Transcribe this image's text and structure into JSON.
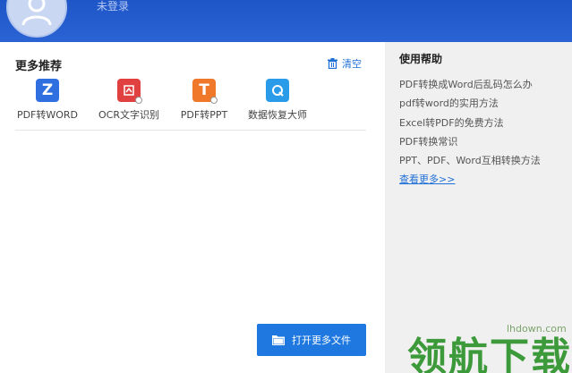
{
  "header": {
    "login_status": "未登录"
  },
  "recommend": {
    "title": "更多推荐",
    "clear_label": "清空",
    "apps": [
      {
        "label": "PDF转WORD",
        "icon": "pdf-to-word-icon",
        "glyph": "Z",
        "color": "#2f6fe0"
      },
      {
        "label": "OCR文字识别",
        "icon": "ocr-icon",
        "glyph": "⎙",
        "color": "#e0403f"
      },
      {
        "label": "PDF转PPT",
        "icon": "pdf-to-ppt-icon",
        "glyph": "T",
        "color": "#f0782a"
      },
      {
        "label": "数据恢复大师",
        "icon": "data-recovery-icon",
        "glyph": "Q",
        "color": "#2a9be8"
      }
    ]
  },
  "open_more_label": "打开更多文件",
  "help": {
    "title": "使用帮助",
    "items": [
      "PDF转换成Word后乱码怎么办",
      "pdf转word的实用方法",
      "Excel转PDF的免费方法",
      "PDF转换常识",
      "PPT、PDF、Word互相转换方法"
    ],
    "see_more": "查看更多>>"
  },
  "watermark": {
    "text": "领航下载",
    "url": "lhdown.com"
  }
}
